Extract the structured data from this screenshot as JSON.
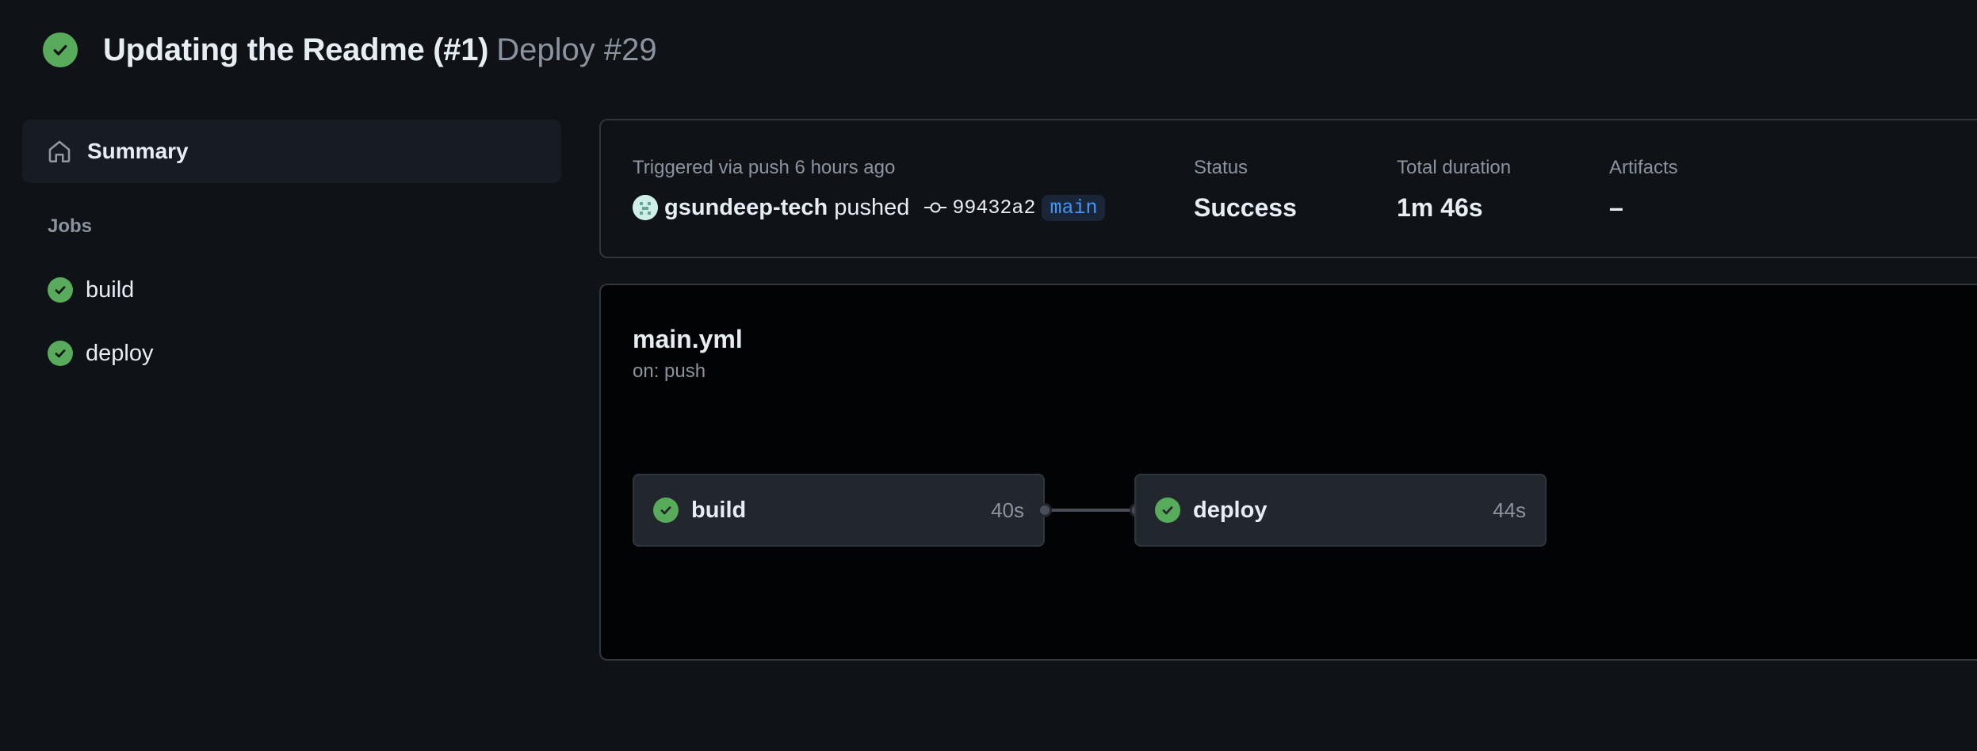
{
  "header": {
    "title": "Updating the Readme (#1)",
    "subtitle": "Deploy #29",
    "status_icon": "check-circle-fill-icon",
    "status_color": "#57ab5a"
  },
  "sidebar": {
    "summary_label": "Summary",
    "summary_icon": "home-icon",
    "jobs_heading": "Jobs",
    "jobs": [
      {
        "label": "build",
        "status": "success"
      },
      {
        "label": "deploy",
        "status": "success"
      }
    ]
  },
  "trigger": {
    "text": "Triggered via push 6 hours ago",
    "actor": "gsundeep-tech",
    "action": "pushed",
    "commit_sha": "99432a2",
    "branch": "main",
    "status_label": "Status",
    "status_value": "Success",
    "duration_label": "Total duration",
    "duration_value": "1m 46s",
    "artifacts_label": "Artifacts",
    "artifacts_value": "–"
  },
  "workflow": {
    "file": "main.yml",
    "on": "on: push",
    "jobs": [
      {
        "name": "build",
        "duration": "40s"
      },
      {
        "name": "deploy",
        "duration": "44s"
      }
    ]
  },
  "colors": {
    "background": "#0f1216",
    "panel": "#171b22",
    "border": "#30363d",
    "success": "#57ab5a",
    "branch_text": "#4493f8",
    "muted_text": "#8b949e"
  }
}
